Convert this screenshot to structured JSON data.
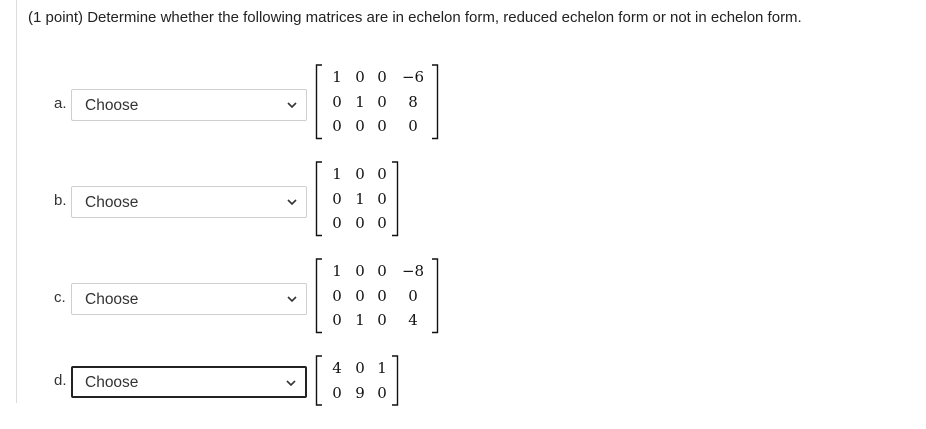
{
  "question": {
    "points": "(1 point)",
    "text": "Determine whether the following matrices are in echelon form, reduced echelon form or not in echelon form."
  },
  "parts": [
    {
      "letter": "a.",
      "select_value": "Choose",
      "focused": false,
      "matrix": [
        [
          "1",
          "0",
          "0",
          "−6"
        ],
        [
          "0",
          "1",
          "0",
          "8"
        ],
        [
          "0",
          "0",
          "0",
          "0"
        ]
      ]
    },
    {
      "letter": "b.",
      "select_value": "Choose",
      "focused": false,
      "matrix": [
        [
          "1",
          "0",
          "0"
        ],
        [
          "0",
          "1",
          "0"
        ],
        [
          "0",
          "0",
          "0"
        ]
      ]
    },
    {
      "letter": "c.",
      "select_value": "Choose",
      "focused": false,
      "matrix": [
        [
          "1",
          "0",
          "0",
          "−8"
        ],
        [
          "0",
          "0",
          "0",
          "0"
        ],
        [
          "0",
          "1",
          "0",
          "4"
        ]
      ]
    },
    {
      "letter": "d.",
      "select_value": "Choose",
      "focused": true,
      "matrix": [
        [
          "4",
          "0",
          "1"
        ],
        [
          "0",
          "9",
          "0"
        ]
      ]
    }
  ],
  "colors": {
    "text": "#222222",
    "select_border": "#cfcfcf",
    "focus_border": "#222222"
  },
  "icons": {
    "select_arrow": "chevron-down-icon"
  }
}
